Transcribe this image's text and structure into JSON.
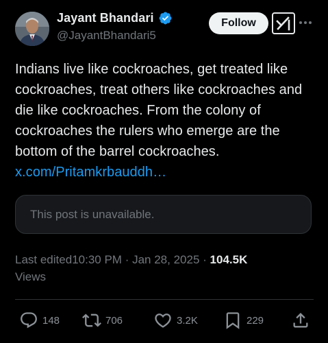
{
  "author": {
    "name": "Jayant Bhandari",
    "handle": "@JayantBhandari5"
  },
  "header": {
    "follow_label": "Follow"
  },
  "post": {
    "text": "Indians live like cockroaches, get treated like cockroaches, treat others like cockroaches and die like cockroaches. From the colony of cockroaches the rulers who emerge are the bottom of the barrel cockroaches.",
    "link_text": "x.com/Pritamkrbauddh…"
  },
  "quote_card": {
    "text": "This post is unavailable."
  },
  "meta": {
    "edited_label": "Last edited",
    "time": "10:30 PM",
    "separator": "·",
    "date": "Jan 28, 2025",
    "views_count": "104.5K",
    "views_label": "Views"
  },
  "actions": {
    "replies": "148",
    "reposts": "706",
    "likes": "3.2K",
    "bookmarks": "229"
  },
  "icons": {
    "verified": "verified-badge-icon",
    "grok": "grok-icon",
    "more": "more-icon",
    "reply": "reply-icon",
    "repost": "repost-icon",
    "like": "like-icon",
    "bookmark": "bookmark-icon",
    "share": "share-icon"
  },
  "colors": {
    "background": "#000000",
    "text_primary": "#e7e9ea",
    "text_secondary": "#71767b",
    "link": "#1d9bf0",
    "verified": "#1d9bf0",
    "follow_bg": "#eff3f4"
  }
}
